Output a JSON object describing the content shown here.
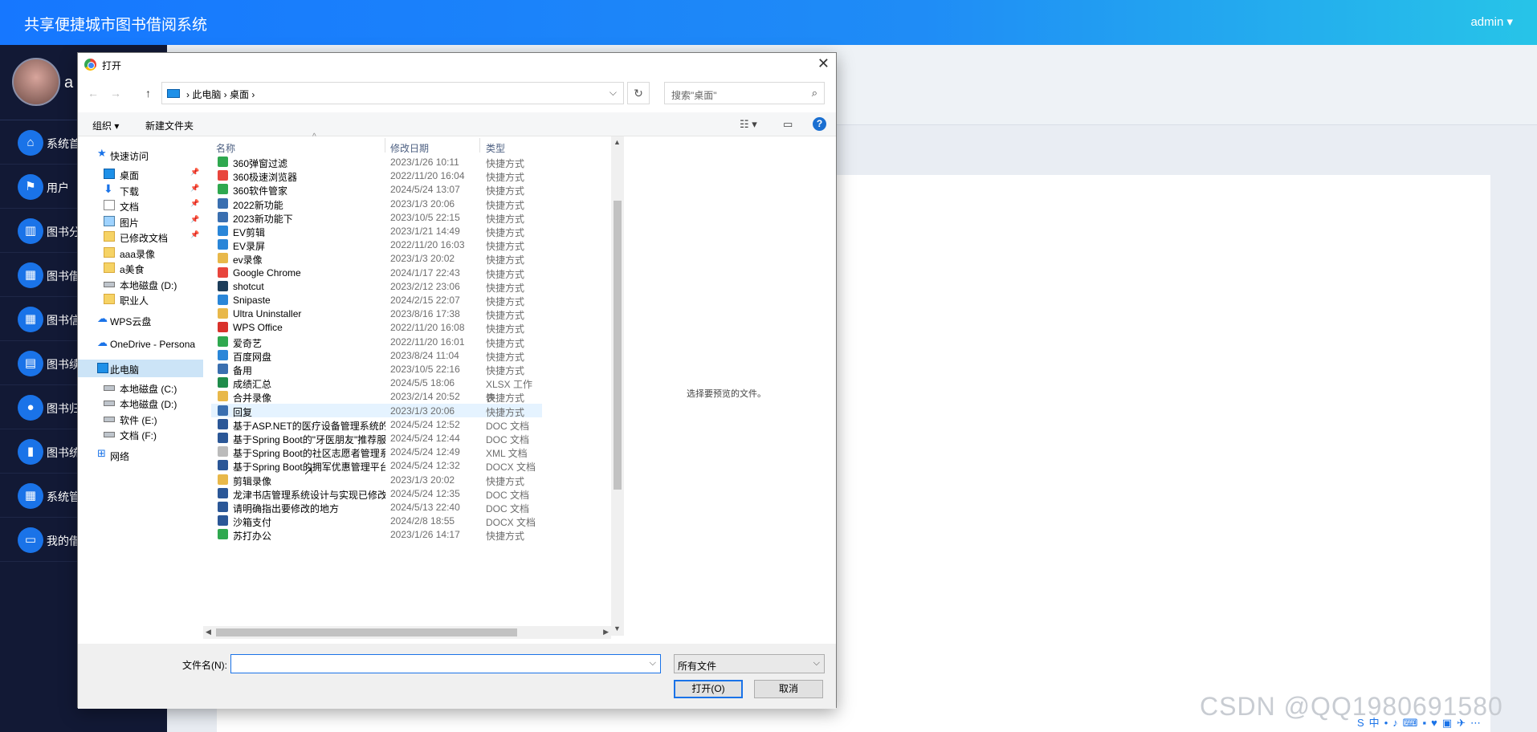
{
  "app": {
    "title": "共享便捷城市图书借阅系统",
    "user": "admin ▾",
    "profile_name": "a"
  },
  "sidebar": {
    "items": [
      {
        "label": "系统首",
        "icon": "⌂"
      },
      {
        "label": "用户",
        "icon": "⚑"
      },
      {
        "label": "图书分",
        "icon": "▥"
      },
      {
        "label": "图书借",
        "icon": "▦"
      },
      {
        "label": "图书信",
        "icon": "▦"
      },
      {
        "label": "图书续",
        "icon": "▤"
      },
      {
        "label": "图书归",
        "icon": "●"
      },
      {
        "label": "图书统",
        "icon": "▮"
      },
      {
        "label": "系统管",
        "icon": "▦"
      },
      {
        "label": "我的借",
        "icon": "▭"
      }
    ]
  },
  "watermark": "CSDN @QQ1980691580",
  "tray_icons": [
    "S",
    "中",
    "•",
    "♪",
    "⌨",
    "▪",
    "♥",
    "▣",
    "✈",
    "⋯"
  ],
  "dialog": {
    "title": "打开",
    "close": "✕",
    "nav": {
      "back": "←",
      "forward": "→",
      "up": "↑"
    },
    "breadcrumb": "›  此电脑  ›  桌面  ›",
    "dropdown": "⌵",
    "refresh": "↻",
    "search_placeholder": "搜索\"桌面\"",
    "search_icon": "⌕",
    "toolbar": {
      "organize": "组织 ▾",
      "new_folder": "新建文件夹",
      "view": "☷ ▾",
      "pane": "▭",
      "help": "?"
    },
    "nav_items": [
      {
        "label": "快速访问",
        "icon": "star",
        "indent": 1,
        "pin": false,
        "sel": false
      },
      {
        "label": "桌面",
        "icon": "blue",
        "indent": 2,
        "pin": true,
        "sel": false
      },
      {
        "label": "下载",
        "icon": "down",
        "indent": 2,
        "pin": true,
        "sel": false
      },
      {
        "label": "文档",
        "icon": "doc",
        "indent": 2,
        "pin": true,
        "sel": false
      },
      {
        "label": "图片",
        "icon": "pic",
        "indent": 2,
        "pin": true,
        "sel": false
      },
      {
        "label": "已修改文档",
        "icon": "folder",
        "indent": 2,
        "pin": true,
        "sel": false
      },
      {
        "label": "aaa录像",
        "icon": "folder",
        "indent": 2,
        "pin": false,
        "sel": false
      },
      {
        "label": "a美食",
        "icon": "folder",
        "indent": 2,
        "pin": false,
        "sel": false
      },
      {
        "label": "本地磁盘 (D:)",
        "icon": "drive",
        "indent": 2,
        "pin": false,
        "sel": false
      },
      {
        "label": "职业人",
        "icon": "folder",
        "indent": 2,
        "pin": false,
        "sel": false
      },
      {
        "label": "WPS云盘",
        "icon": "cloud",
        "indent": 1,
        "pin": false,
        "sel": false,
        "gap": true
      },
      {
        "label": "OneDrive - Persona",
        "icon": "cloud",
        "indent": 1,
        "pin": false,
        "sel": false,
        "gap": true
      },
      {
        "label": "此电脑",
        "icon": "blue",
        "indent": 1,
        "pin": false,
        "sel": true,
        "gap": true
      },
      {
        "label": "本地磁盘 (C:)",
        "icon": "drive",
        "indent": 2,
        "pin": false,
        "sel": false
      },
      {
        "label": "本地磁盘 (D:)",
        "icon": "drive",
        "indent": 2,
        "pin": false,
        "sel": false
      },
      {
        "label": "软件 (E:)",
        "icon": "drive",
        "indent": 2,
        "pin": false,
        "sel": false
      },
      {
        "label": "文档 (F:)",
        "icon": "drive",
        "indent": 2,
        "pin": false,
        "sel": false
      },
      {
        "label": "网络",
        "icon": "net",
        "indent": 1,
        "pin": false,
        "sel": false,
        "gap": true
      }
    ],
    "columns": {
      "name": "名称",
      "date": "修改日期",
      "type": "类型"
    },
    "files": [
      {
        "name": "360弹窗过滤",
        "date": "2023/1/26 10:11",
        "type": "快捷方式",
        "color": "#2fa84f"
      },
      {
        "name": "360极速浏览器",
        "date": "2022/11/20 16:04",
        "type": "快捷方式",
        "color": "#e8453c"
      },
      {
        "name": "360软件管家",
        "date": "2024/5/24 13:07",
        "type": "快捷方式",
        "color": "#2fa84f"
      },
      {
        "name": "2022新功能",
        "date": "2023/1/3 20:06",
        "type": "快捷方式",
        "color": "#3a6fb0"
      },
      {
        "name": "2023新功能下",
        "date": "2023/10/5 22:15",
        "type": "快捷方式",
        "color": "#3a6fb0"
      },
      {
        "name": "EV剪辑",
        "date": "2023/1/21 14:49",
        "type": "快捷方式",
        "color": "#2a86d8"
      },
      {
        "name": "EV录屏",
        "date": "2022/11/20 16:03",
        "type": "快捷方式",
        "color": "#2a86d8"
      },
      {
        "name": "ev录像",
        "date": "2023/1/3 20:02",
        "type": "快捷方式",
        "color": "#e8b84a"
      },
      {
        "name": "Google Chrome",
        "date": "2024/1/17 22:43",
        "type": "快捷方式",
        "color": "#e8453c"
      },
      {
        "name": "shotcut",
        "date": "2023/2/12 23:06",
        "type": "快捷方式",
        "color": "#1c3d5a"
      },
      {
        "name": "Snipaste",
        "date": "2024/2/15 22:07",
        "type": "快捷方式",
        "color": "#2a86d8"
      },
      {
        "name": "Ultra Uninstaller",
        "date": "2023/8/16 17:38",
        "type": "快捷方式",
        "color": "#e8b84a"
      },
      {
        "name": "WPS Office",
        "date": "2022/11/20 16:08",
        "type": "快捷方式",
        "color": "#d9322b"
      },
      {
        "name": "爱奇艺",
        "date": "2022/11/20 16:01",
        "type": "快捷方式",
        "color": "#2fa84f"
      },
      {
        "name": "百度网盘",
        "date": "2023/8/24 11:04",
        "type": "快捷方式",
        "color": "#2a86d8"
      },
      {
        "name": "备用",
        "date": "2023/10/5 22:16",
        "type": "快捷方式",
        "color": "#3a6fb0"
      },
      {
        "name": "成绩汇总",
        "date": "2024/5/5 18:06",
        "type": "XLSX 工作表",
        "color": "#1f8c4a"
      },
      {
        "name": "合并录像",
        "date": "2023/2/14 20:52",
        "type": "快捷方式",
        "color": "#e8b84a"
      },
      {
        "name": "回复",
        "date": "2023/1/3 20:06",
        "type": "快捷方式",
        "color": "#3a6fb0"
      },
      {
        "name": "基于ASP.NET的医疗设备管理系统的设计...",
        "date": "2024/5/24 12:52",
        "type": "DOC 文档",
        "color": "#2b5797"
      },
      {
        "name": "基于Spring Boot的\"牙医朋友\"推荐服务...",
        "date": "2024/5/24 12:44",
        "type": "DOC 文档",
        "color": "#2b5797"
      },
      {
        "name": "基于Spring Boot的社区志愿者管理系统...",
        "date": "2024/5/24 12:49",
        "type": "XML 文档",
        "color": "#bbbbbb"
      },
      {
        "name": "基于Spring Boot的拥军优惠管理平台设...",
        "date": "2024/5/24 12:32",
        "type": "DOCX 文档",
        "color": "#2b5797"
      },
      {
        "name": "剪辑录像",
        "date": "2023/1/3 20:02",
        "type": "快捷方式",
        "color": "#e8b84a"
      },
      {
        "name": "龙津书店管理系统设计与实现已修改",
        "date": "2024/5/24 12:35",
        "type": "DOC 文档",
        "color": "#2b5797"
      },
      {
        "name": "请明确指出要修改的地方",
        "date": "2024/5/13 22:40",
        "type": "DOC 文档",
        "color": "#2b5797"
      },
      {
        "name": "沙箱支付",
        "date": "2024/2/8 18:55",
        "type": "DOCX 文档",
        "color": "#2b5797"
      },
      {
        "name": "苏打办公",
        "date": "2023/1/26 14:17",
        "type": "快捷方式",
        "color": "#2fa84f"
      }
    ],
    "preview_text": "选择要预览的文件。",
    "filename_label": "文件名(N):",
    "filename_value": "",
    "filetype_value": "所有文件",
    "open_button": "打开(O)",
    "cancel_button": "取消",
    "sort_indicator": "^",
    "vscroll_up": "▲",
    "vscroll_down": "▼",
    "hscroll_left": "◀",
    "hscroll_right": "▶"
  }
}
